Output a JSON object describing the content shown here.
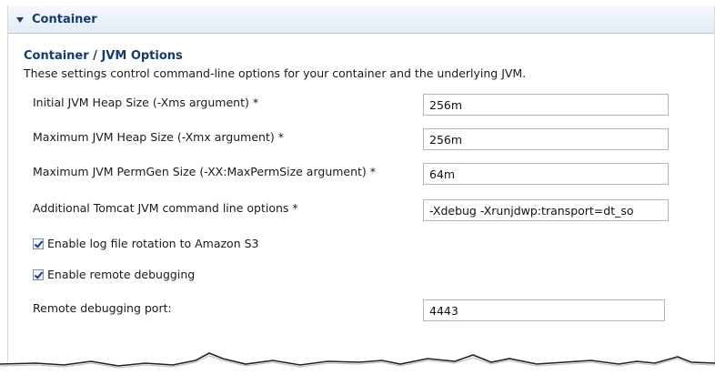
{
  "section": {
    "title": "Container"
  },
  "group": {
    "title": "Container / JVM Options",
    "description": "These settings control command-line options for your container and the underlying JVM."
  },
  "fields": {
    "initial_heap": {
      "label": "Initial JVM Heap Size (-Xms argument) *",
      "value": "256m"
    },
    "max_heap": {
      "label": "Maximum JVM Heap Size (-Xmx argument) *",
      "value": "256m"
    },
    "max_permgen": {
      "label": "Maximum JVM PermGen Size (-XX:MaxPermSize argument) *",
      "value": "64m"
    },
    "tomcat_options": {
      "label": "Additional Tomcat JVM command line options *",
      "value": "-Xdebug -Xrunjdwp:transport=dt_so"
    },
    "log_rotation": {
      "label": "Enable log file rotation to Amazon S3",
      "checked": true
    },
    "remote_debugging": {
      "label": "Enable remote debugging",
      "checked": true
    },
    "debug_port": {
      "label": "Remote debugging port:",
      "value": "4443"
    }
  },
  "colors": {
    "header_text": "#163a6b",
    "header_bg": "#e3ebf5"
  },
  "icons": {
    "section_toggle": "triangle-down-icon",
    "checkbox_mark": "checkmark-icon"
  }
}
